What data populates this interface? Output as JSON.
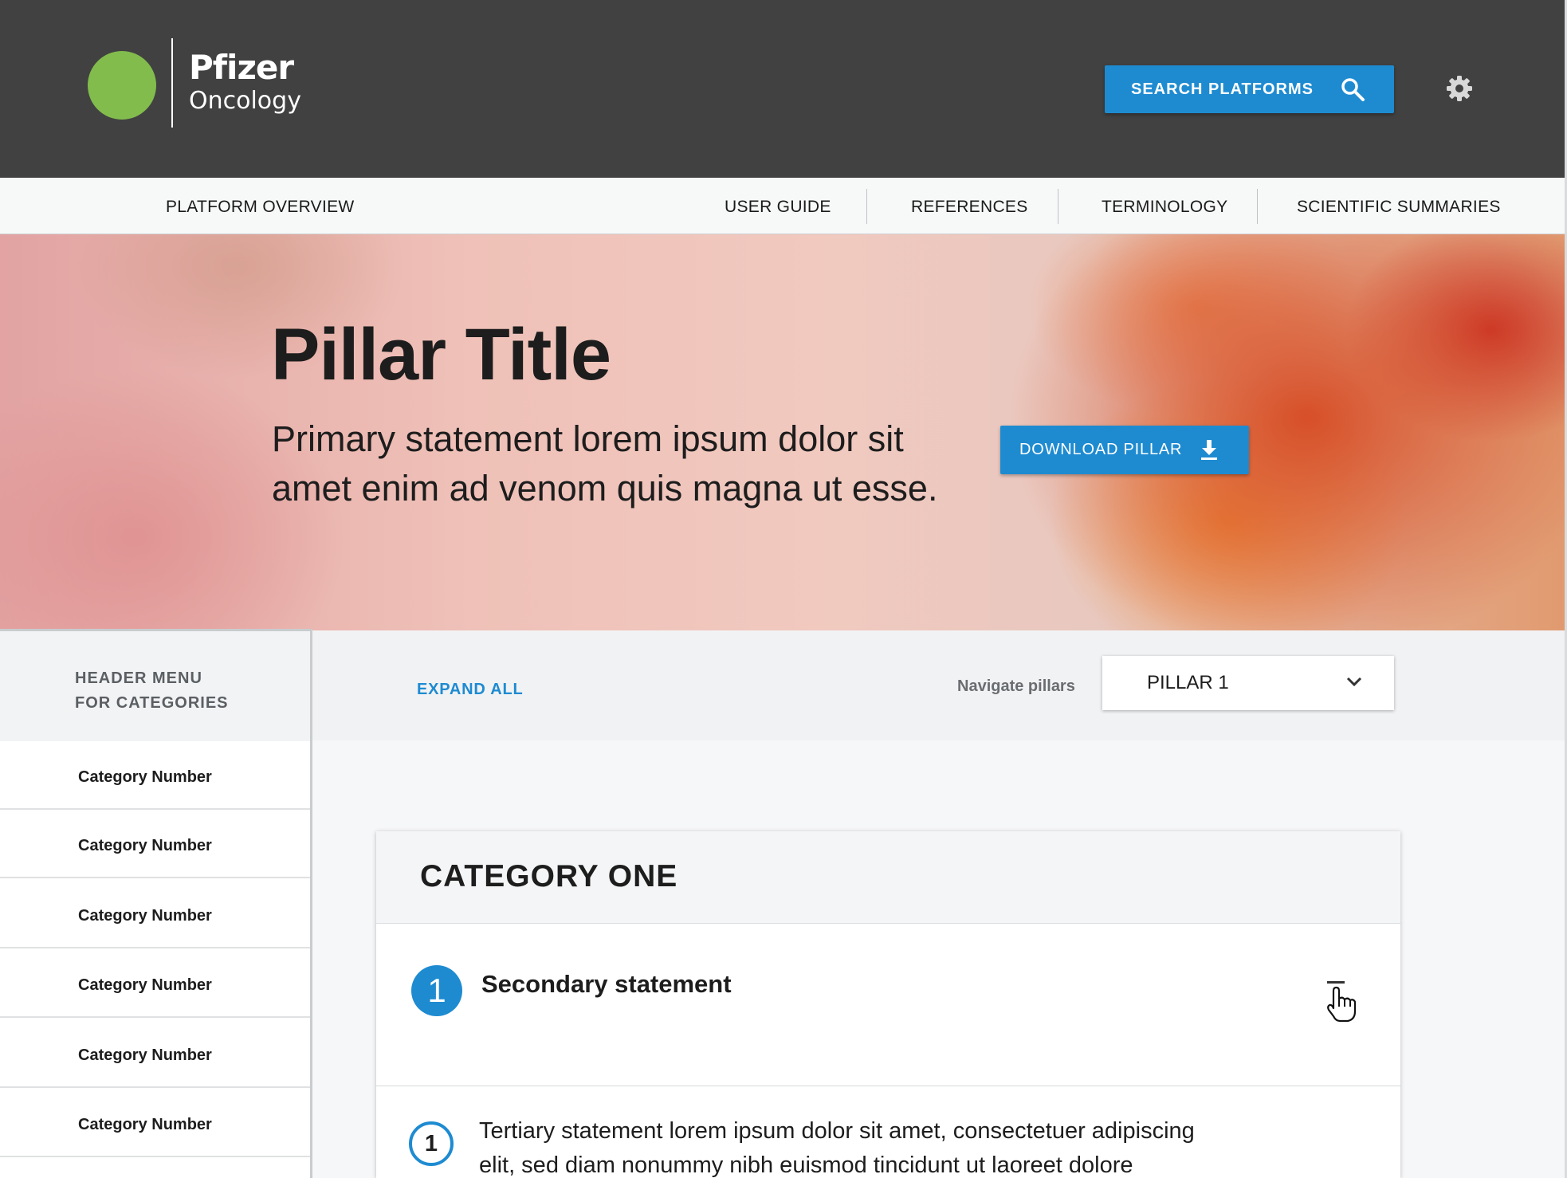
{
  "brand": {
    "name": "Pfizer",
    "division": "Oncology",
    "circle_color": "#82bc4d"
  },
  "header": {
    "search_label": "SEARCH PLATFORMS",
    "search_icon": "search-icon",
    "settings_icon": "gear-icon",
    "background": "#414141",
    "accent": "#1e8bd1"
  },
  "nav": {
    "overview": "PLATFORM OVERVIEW",
    "links": [
      "USER GUIDE",
      "REFERENCES",
      "TERMINOLOGY",
      "SCIENTIFIC SUMMARIES"
    ]
  },
  "hero": {
    "title": "Pillar Title",
    "statement": "Primary statement lorem ipsum dolor sit amet enim ad venom quis magna ut esse.",
    "download_label": "DOWNLOAD PILLAR",
    "download_icon": "download-icon"
  },
  "sidebar": {
    "header": "HEADER MENU FOR CATEGORIES",
    "items": [
      "Category Number",
      "Category Number",
      "Category Number",
      "Category Number",
      "Category Number",
      "Category Number"
    ]
  },
  "toolbar": {
    "expand_all": "EXPAND ALL",
    "navigate_label": "Navigate pillars",
    "pillar_selected": "PILLAR 1",
    "dropdown_icon": "chevron-down-icon"
  },
  "category": {
    "title": "CATEGORY ONE",
    "secondary_number": "1",
    "secondary_text": "Secondary statement",
    "collapse_icon": "collapse-minus-icon",
    "tertiary_number": "1",
    "tertiary_text": "Tertiary statement lorem ipsum dolor sit amet, consectetuer adipiscing elit, sed diam nonummy nibh euismod tincidunt ut laoreet dolore magna aliquam erat volutpat. Ut wisi enim ad"
  }
}
